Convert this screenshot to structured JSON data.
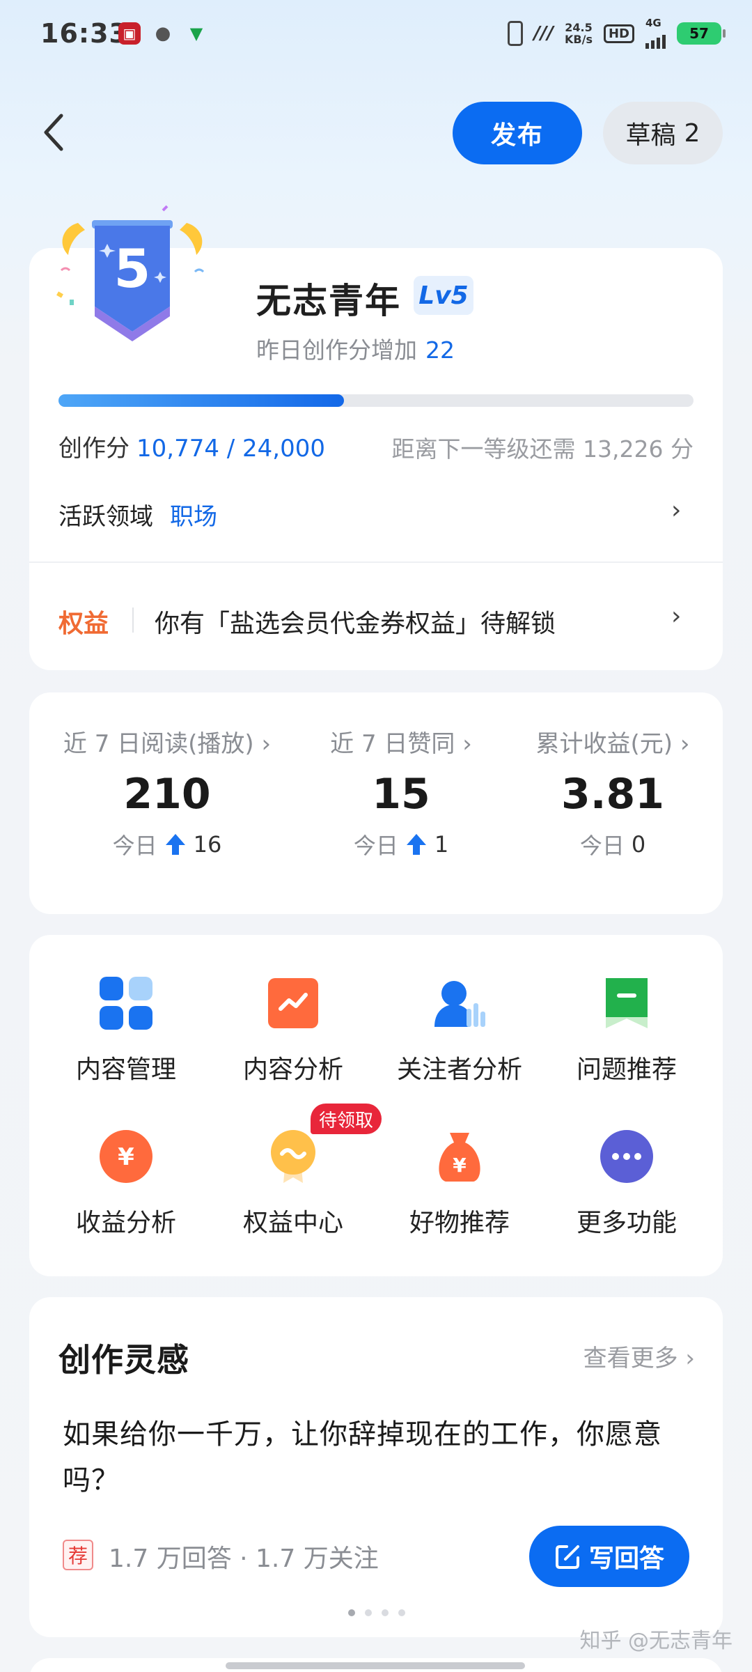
{
  "status_bar": {
    "time": "16:33",
    "speed_value": "24.5",
    "speed_unit": "KB/s",
    "hd": "HD",
    "network": "4G",
    "battery": "57"
  },
  "header": {
    "publish_label": "发布",
    "draft_label": "草稿",
    "draft_count": "2"
  },
  "profile": {
    "level_number": "5",
    "name": "无志青年",
    "level_tag": "Lv5",
    "yesterday_label": "昨日创作分增加",
    "yesterday_value": "22",
    "progress": 0.45,
    "score_label": "创作分",
    "score_value": "10,774 / 24,000",
    "next_level_text": "距离下一等级还需 13,226 分",
    "domain_label": "活跃领域",
    "domain_value": "职场",
    "benefit_label": "权益",
    "benefit_text": "你有「盐选会员代金券权益」待解锁"
  },
  "stats": [
    {
      "label": "近 7 日阅读(播放) ›",
      "value": "210",
      "today_label": "今日",
      "today_value": "16",
      "up": true
    },
    {
      "label": "近 7 日赞同 ›",
      "value": "15",
      "today_label": "今日",
      "today_value": "1",
      "up": true
    },
    {
      "label": "累计收益(元) ›",
      "value": "3.81",
      "today_label": "今日",
      "today_value": "0",
      "up": false
    }
  ],
  "features": [
    {
      "label": "内容管理",
      "icon": "grid-icon"
    },
    {
      "label": "内容分析",
      "icon": "trend-chart-icon"
    },
    {
      "label": "关注者分析",
      "icon": "follower-chart-icon"
    },
    {
      "label": "问题推荐",
      "icon": "question-flag-icon"
    },
    {
      "label": "收益分析",
      "icon": "yuan-coin-icon"
    },
    {
      "label": "权益中心",
      "icon": "medal-icon"
    },
    {
      "label": "好物推荐",
      "icon": "money-bag-icon"
    },
    {
      "label": "更多功能",
      "icon": "more-dots-icon"
    }
  ],
  "pending_tag": "待领取",
  "inspiration": {
    "title": "创作灵感",
    "more": "查看更多 ›",
    "question": "如果给你一千万，让你辞掉现在的工作，你愿意吗？",
    "rec_tag": "荐",
    "meta": "1.7 万回答 · 1.7 万关注",
    "answer_label": "写回答"
  },
  "watermark": "知乎 @无志青年",
  "colors": {
    "accent": "#0b6cf2",
    "benefit": "#f06a33",
    "badge": "#4a78e8",
    "pending": "#e8263a"
  }
}
